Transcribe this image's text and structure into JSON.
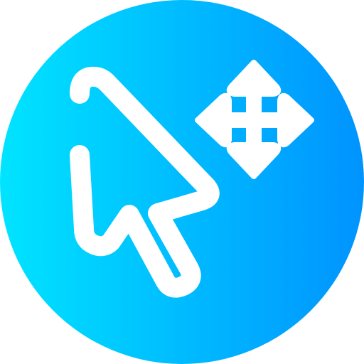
{
  "icon": {
    "name": "move-cursor-icon",
    "gradient_start": "#00e4ff",
    "gradient_end": "#0093ff",
    "glyph_color": "#ffffff"
  }
}
